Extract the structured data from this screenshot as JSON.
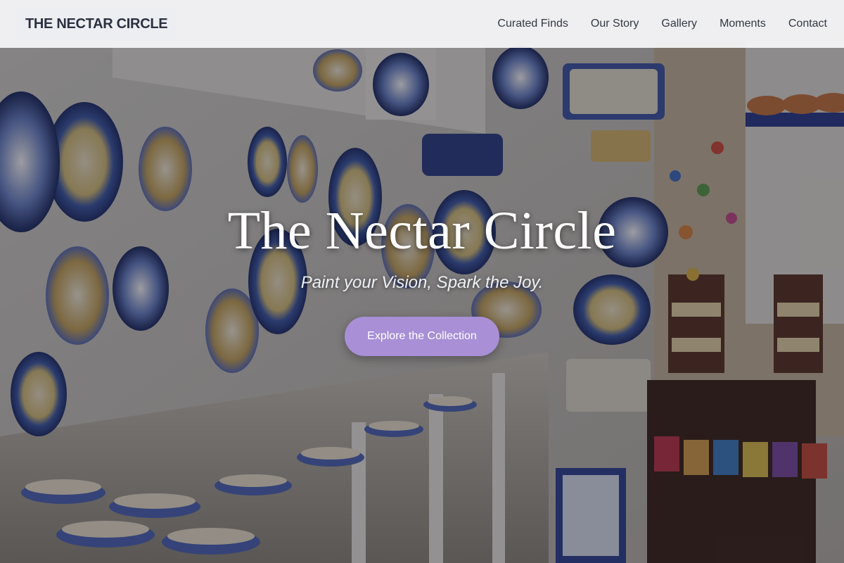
{
  "navbar": {
    "brand": "THE NECTAR CIRCLE",
    "links": [
      "Curated Finds",
      "Our Story",
      "Gallery",
      "Moments",
      "Contact"
    ]
  },
  "hero": {
    "title": "The Nectar Circle",
    "subtitle": "Paint your Vision, Spark the Joy.",
    "cta_label": "Explore the Collection"
  },
  "colors": {
    "accent": "#a88fd6",
    "navbar_bg": "#f8f8fa",
    "brand_text": "#2b3140",
    "hero_text": "#ffffff"
  }
}
